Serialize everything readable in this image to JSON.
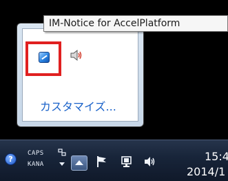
{
  "tooltip": {
    "text": "IM-Notice for AccelPlatform"
  },
  "tray_popup": {
    "icons": [
      {
        "name": "im-notice-icon",
        "selected": true
      },
      {
        "name": "speaker-icon",
        "selected": false
      }
    ],
    "customize_label": "カスタマイズ..."
  },
  "taskbar": {
    "ime": {
      "caps_label": "CAPS",
      "kana_label": "KANA"
    },
    "tray_icons": [
      "show-hidden-icons-icon",
      "action-center-flag-icon",
      "network-icon",
      "volume-icon"
    ],
    "clock": {
      "time": "15:4",
      "date": "2014/1"
    }
  },
  "colors": {
    "highlight_border": "#e02020",
    "link": "#1a62c9",
    "taskbar": "#18253a"
  }
}
